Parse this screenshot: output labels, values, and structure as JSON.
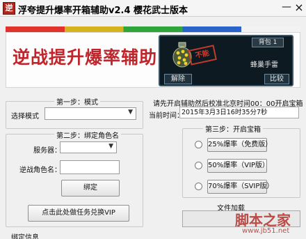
{
  "window": {
    "icon_char": "逆",
    "title": "浮夸提升爆率开箱辅助v2.4  樱花武士版本",
    "minimize": "—",
    "close": "×"
  },
  "colors": {
    "strip": [
      "#e0332b",
      "#d6b21c",
      "#2fa63c",
      "#2a64c9",
      "#f2f2f2"
    ],
    "banner_title": "#c0252c",
    "card_bg": "#0e1a22"
  },
  "banner": {
    "title": "逆战提升爆率辅助",
    "card": {
      "backpack_label": "背包 1",
      "weapon_name": "蜂巢手雷",
      "stamp": "不能",
      "dismiss_label": "解除",
      "compare_label": "比较"
    }
  },
  "step1": {
    "title": "第一步：模式",
    "mode_label": "选择模式",
    "mode_value": ""
  },
  "step2": {
    "title": "第二步：绑定角色名",
    "server_label": "服务器：",
    "server_value": "",
    "name_label": "逆战角色名：",
    "name_value": "",
    "bind_label": "绑定",
    "vip_label": "点击此处做任务兑换VIP"
  },
  "bind_info": {
    "title": "绑定信息"
  },
  "right": {
    "notice": "请先开启辅助然后校准北京时间00：00开启宝箱",
    "time_label": "当前时间：",
    "time_value": "2015年3月3日16时35分7秒"
  },
  "step3": {
    "title": "第三步：开启宝箱",
    "options": [
      {
        "label": "25%爆率（免费版）"
      },
      {
        "label": "50%爆率（VIP版）"
      },
      {
        "label": "70%爆率（SVIP版）"
      }
    ]
  },
  "file_load": {
    "label": "文件加载"
  },
  "watermark": {
    "text": "脚本之家",
    "url": "www.jb51.net"
  }
}
